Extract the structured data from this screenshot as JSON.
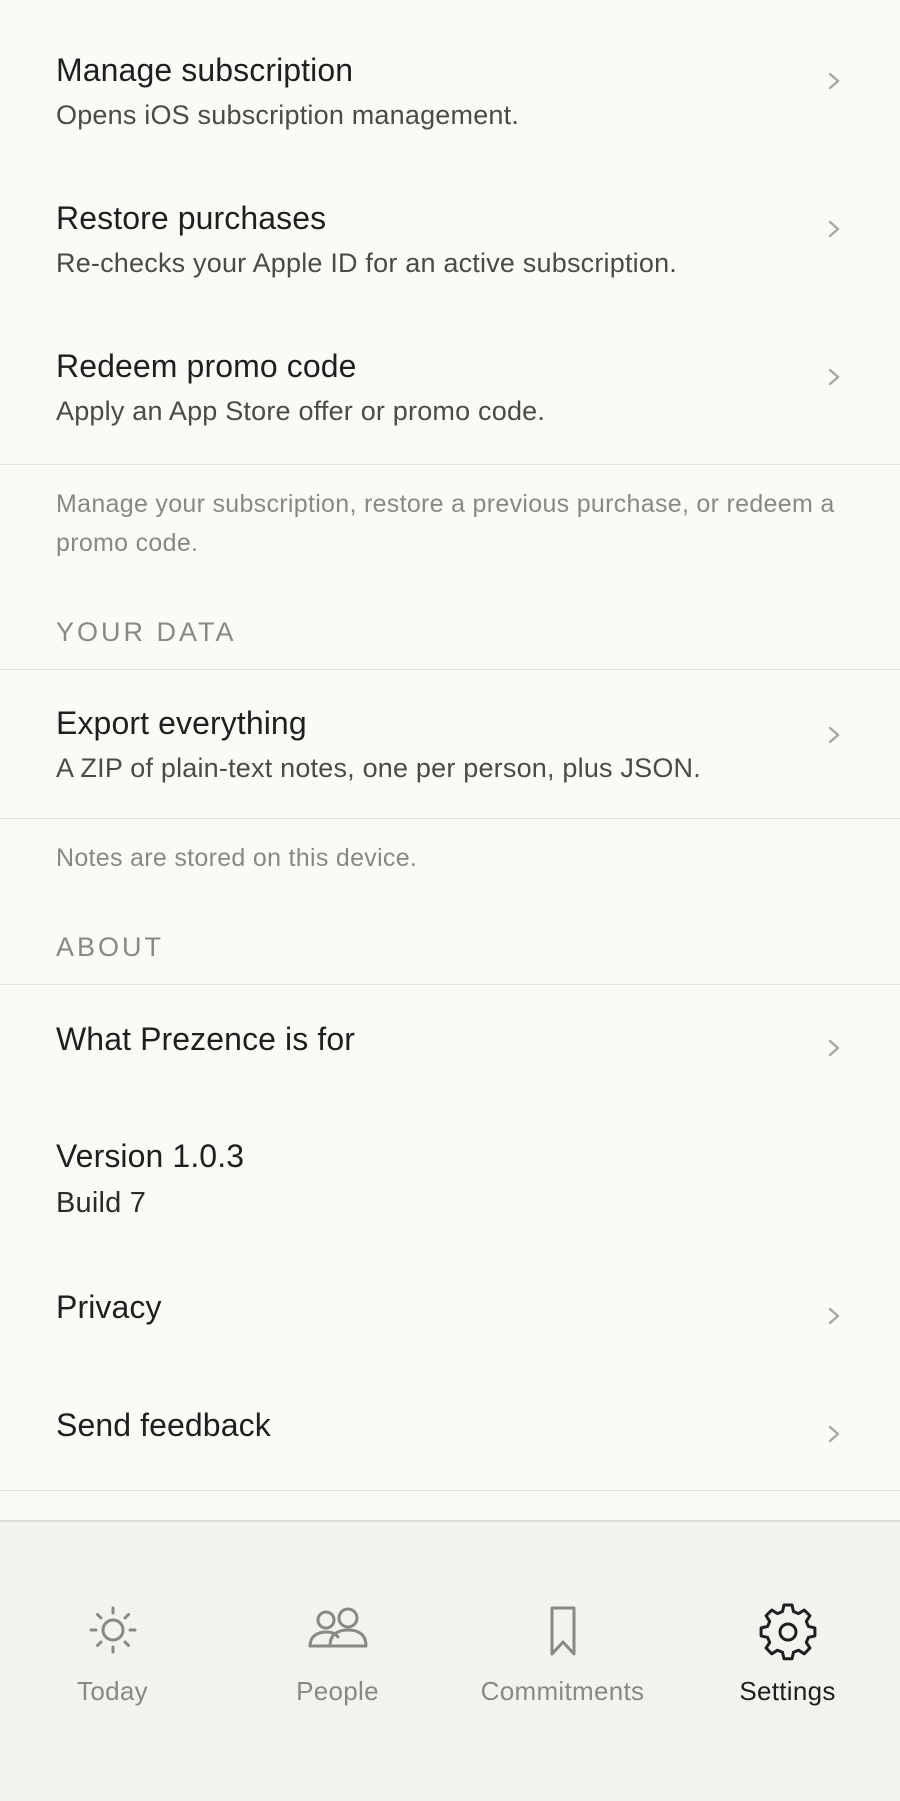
{
  "subscription": {
    "items": [
      {
        "title": "Manage subscription",
        "subtitle": "Opens iOS subscription management."
      },
      {
        "title": "Restore purchases",
        "subtitle": "Re-checks your Apple ID for an active subscription."
      },
      {
        "title": "Redeem promo code",
        "subtitle": "Apply an App Store offer or promo code."
      }
    ],
    "footnote": "Manage your subscription, restore a previous purchase, or redeem a promo code."
  },
  "your_data": {
    "header": "YOUR DATA",
    "items": [
      {
        "title": "Export everything",
        "subtitle": "A ZIP of plain-text notes, one per person, plus JSON."
      }
    ],
    "footnote": "Notes are stored on this device."
  },
  "about": {
    "header": "ABOUT",
    "items": [
      {
        "title": "What Prezence is for"
      },
      {
        "title": "Version 1.0.3",
        "subtitle": "Build 7"
      },
      {
        "title": "Privacy"
      },
      {
        "title": "Send feedback"
      }
    ]
  },
  "tabbar": {
    "active": "Settings",
    "tabs": [
      {
        "label": "Today",
        "icon": "sun-icon"
      },
      {
        "label": "People",
        "icon": "people-icon"
      },
      {
        "label": "Commitments",
        "icon": "bookmark-icon"
      },
      {
        "label": "Settings",
        "icon": "gear-icon"
      }
    ]
  },
  "colors": {
    "background": "#fbfaf6",
    "tabbar_background": "#f3f2ee",
    "primary_text": "#1f1f1f",
    "secondary_text": "#4a4a47",
    "muted_text": "#8a8883",
    "chevron": "#a9a7a2"
  }
}
